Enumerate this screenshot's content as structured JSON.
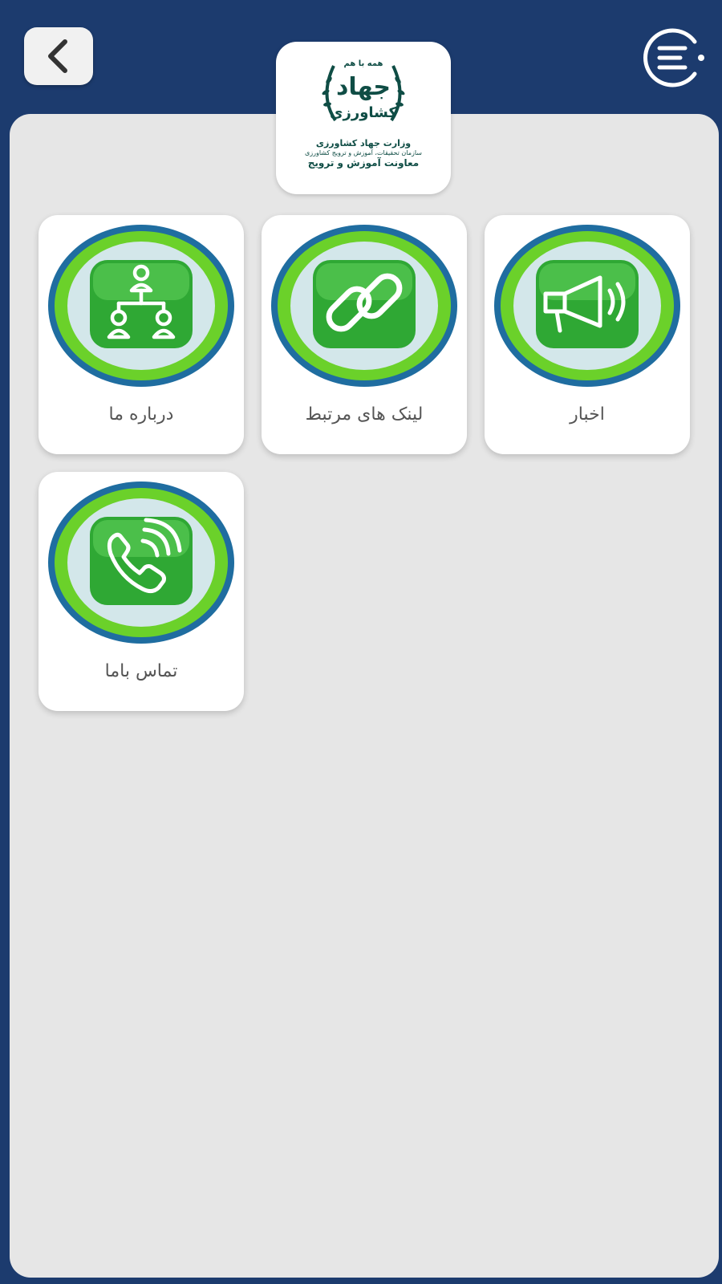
{
  "header": {
    "back_icon": "chevron-left-icon",
    "menu_icon": "menu-icon"
  },
  "logo": {
    "tagline": "همه با هم",
    "name_line1": "جهاد",
    "name_line2": "کشاورزی",
    "ministry": "وزارت جهاد کشاورزی",
    "organization": "سازمان تحقیقات، آموزش و ترویج کشاورزی",
    "deputy": "معاونت آموزش و ترویج"
  },
  "tiles": [
    {
      "label": "اخبار",
      "icon": "megaphone-icon"
    },
    {
      "label": "لینک های مرتبط",
      "icon": "link-icon"
    },
    {
      "label": "درباره ما",
      "icon": "organization-icon"
    },
    {
      "label": "تماس باما",
      "icon": "phone-icon"
    }
  ],
  "colors": {
    "header_bg": "#1c3b6e",
    "panel_bg": "#e6e6e6",
    "icon_green": "#2fa834",
    "ring_blue": "#1f6da0"
  }
}
